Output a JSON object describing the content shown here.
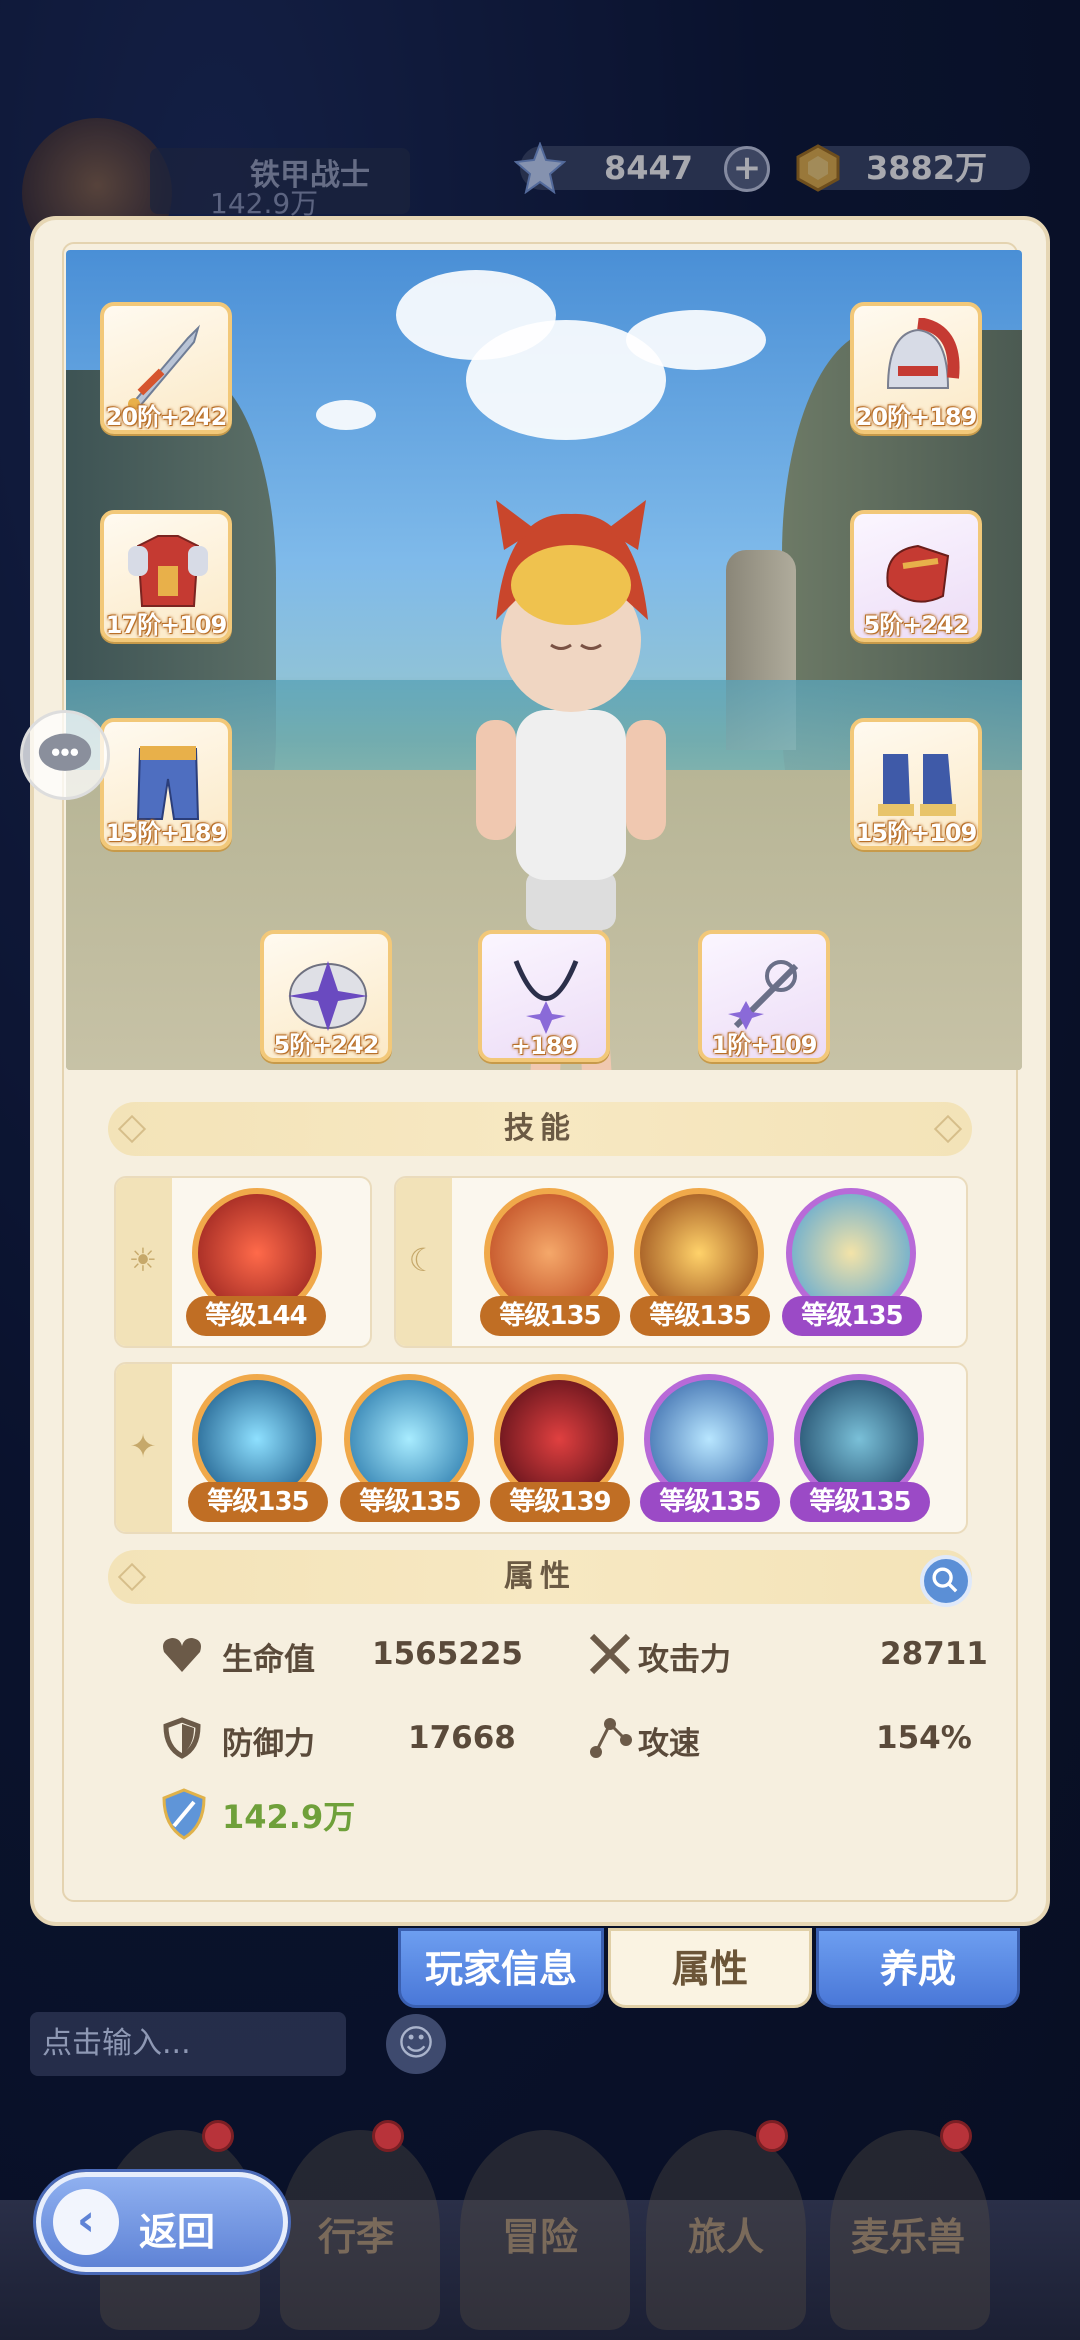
{
  "header": {
    "player_name": "铁甲战士",
    "player_power": "142.9万",
    "gems": "8447",
    "gold": "3882万"
  },
  "equipment": {
    "weapon": "20阶+242",
    "helmet": "20阶+189",
    "armor": "17阶+109",
    "gloves": "5阶+242",
    "pants": "15阶+189",
    "boots": "15阶+109",
    "mask": "5阶+242",
    "necklace": "+189",
    "accessory": "1阶+109"
  },
  "skills_title": "技能",
  "skills_row1_left": [
    {
      "level": "等级144"
    }
  ],
  "skills_row1_right": [
    {
      "level": "等级135"
    },
    {
      "level": "等级135"
    },
    {
      "level": "等级135"
    }
  ],
  "skills_row2": [
    {
      "level": "等级135"
    },
    {
      "level": "等级135"
    },
    {
      "level": "等级139"
    },
    {
      "level": "等级135"
    },
    {
      "level": "等级135"
    }
  ],
  "attrs_title": "属性",
  "attrs": {
    "hp_label": "生命值",
    "hp": "1565225",
    "atk_label": "攻击力",
    "atk": "28711",
    "def_label": "防御力",
    "def": "17668",
    "spd_label": "攻速",
    "spd": "154%",
    "power": "142.9万"
  },
  "tabs": {
    "info": "玩家信息",
    "attrs": "属性",
    "grow": "养成"
  },
  "chat": {
    "placeholder": "点击输入..."
  },
  "nav": {
    "back": "返回",
    "bag": "行李",
    "adventure": "冒险",
    "traveler": "旅人",
    "pets": "麦乐兽"
  },
  "colors": {
    "accent_orange": "#f0a94a",
    "accent_purple": "#b86ad8",
    "power_green": "#6fa03a",
    "tab_blue": "#4a78d8"
  }
}
